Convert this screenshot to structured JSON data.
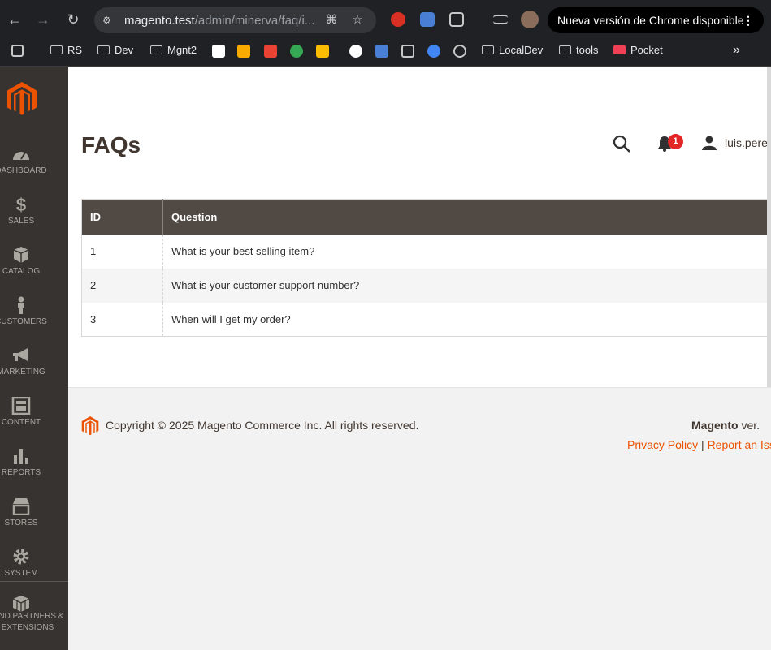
{
  "browser": {
    "url_host": "magento.test",
    "url_path": "/admin/minerva/faq/i...",
    "update_label": "Nueva versión de Chrome disponible",
    "bookmarks": [
      "RS",
      "Dev",
      "Mgnt2",
      "LocalDev",
      "tools",
      "Pocket"
    ]
  },
  "sidebar": {
    "items": [
      {
        "label": "Dashboard",
        "icon": "dashboard-icon"
      },
      {
        "label": "Sales",
        "icon": "dollar-icon"
      },
      {
        "label": "Catalog",
        "icon": "box-icon"
      },
      {
        "label": "Customers",
        "icon": "person-icon"
      },
      {
        "label": "Marketing",
        "icon": "megaphone-icon"
      },
      {
        "label": "Content",
        "icon": "content-icon"
      },
      {
        "label": "Reports",
        "icon": "bar-chart-icon"
      },
      {
        "label": "Stores",
        "icon": "storefront-icon"
      },
      {
        "label": "System",
        "icon": "gear-icon"
      }
    ],
    "partners_label": "Find Partners & Extensions"
  },
  "header": {
    "title": "FAQs",
    "notifications_count": "1",
    "user": "luis.perez"
  },
  "grid": {
    "columns": [
      "ID",
      "Question"
    ],
    "rows": [
      {
        "id": "1",
        "question": "What is your best selling item?"
      },
      {
        "id": "2",
        "question": "What is your customer support number?"
      },
      {
        "id": "3",
        "question": "When will I get my order?"
      }
    ]
  },
  "footer": {
    "copyright": "Copyright © 2025 Magento Commerce Inc. All rights reserved.",
    "brand": "Magento",
    "version_suffix": " ver.",
    "privacy_label": "Privacy Policy",
    "separator": " | ",
    "report_label": "Report an Issue"
  },
  "colors": {
    "accent": "#eb5202",
    "sidebar": "#373330",
    "grid_header": "#514943",
    "badge": "#e22626"
  }
}
